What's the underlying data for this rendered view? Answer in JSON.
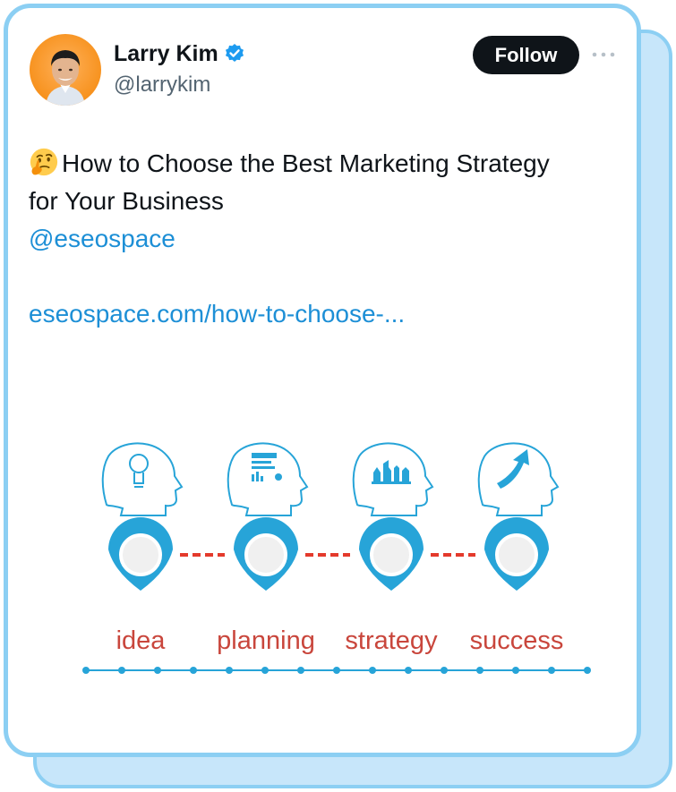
{
  "author": {
    "name": "Larry Kim",
    "handle": "@larrykim",
    "verified": true,
    "avatar_icon": "avatar-photo"
  },
  "actions": {
    "follow_label": "Follow",
    "more_icon": "more-options-icon"
  },
  "tweet": {
    "emoji": "🤔",
    "line1": "How to Choose the Best Marketing Strategy",
    "line2": "for Your Business",
    "mention": "@eseospace",
    "link": "eseospace.com/how-to-choose-..."
  },
  "media": {
    "stages": [
      {
        "label": "idea",
        "icon": "lightbulb-head-icon"
      },
      {
        "label": "planning",
        "icon": "planning-document-head-icon"
      },
      {
        "label": "strategy",
        "icon": "chess-head-icon"
      },
      {
        "label": "success",
        "icon": "arrow-up-head-icon"
      }
    ]
  },
  "colors": {
    "card_border": "#8ccff3",
    "card_shadow": "#c7e6fa",
    "link": "#1d8fd6",
    "pin": "#27a4d8",
    "label_red": "#c9463c",
    "dash_red": "#e43a2c"
  }
}
